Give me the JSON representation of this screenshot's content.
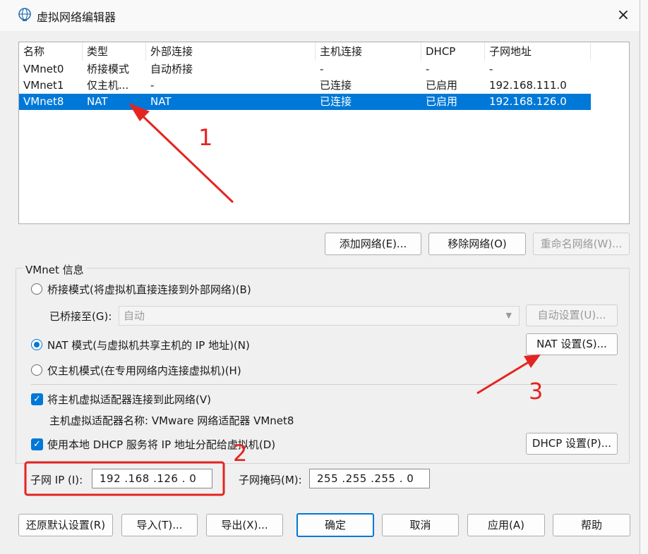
{
  "window": {
    "title": "虚拟网络编辑器",
    "close_icon": "×"
  },
  "table": {
    "headers": [
      "名称",
      "类型",
      "外部连接",
      "主机连接",
      "DHCP",
      "子网地址"
    ],
    "rows": [
      [
        "VMnet0",
        "桥接模式",
        "自动桥接",
        "-",
        "-",
        "-"
      ],
      [
        "VMnet1",
        "仅主机...",
        "-",
        "已连接",
        "已启用",
        "192.168.111.0"
      ],
      [
        "VMnet8",
        "NAT",
        "NAT",
        "已连接",
        "已启用",
        "192.168.126.0"
      ]
    ],
    "selected_row": 2
  },
  "list_buttons": {
    "add": "添加网络(E)...",
    "remove": "移除网络(O)",
    "rename": "重命名网络(W)..."
  },
  "info": {
    "group_label": "VMnet 信息",
    "bridge_mode": "桥接模式(将虚拟机直接连接到外部网络)(B)",
    "bridged_to_label": "已桥接至(G):",
    "bridged_to_value": "自动",
    "auto_settings": "自动设置(U)...",
    "nat_mode": "NAT 模式(与虚拟机共享主机的 IP 地址)(N)",
    "nat_settings": "NAT 设置(S)...",
    "host_only_mode": "仅主机模式(在专用网络内连接虚拟机)(H)",
    "connect_adapter": "将主机虚拟适配器连接到此网络(V)",
    "adapter_name": "主机虚拟适配器名称: VMware 网络适配器 VMnet8",
    "use_dhcp": "使用本地 DHCP 服务将 IP 地址分配给虚拟机(D)",
    "dhcp_settings": "DHCP 设置(P)...",
    "subnet_ip_label": "子网 IP (I):",
    "subnet_ip": "192 .168 .126 .  0",
    "subnet_mask_label": "子网掩码(M):",
    "subnet_mask": "255 .255 .255 .  0"
  },
  "bottom_buttons": {
    "restore": "还原默认设置(R)",
    "import": "导入(T)...",
    "export": "导出(X)...",
    "ok": "确定",
    "cancel": "取消",
    "apply": "应用(A)",
    "help": "帮助"
  },
  "annotations": {
    "one": "1",
    "two": "2",
    "three": "3",
    "color": "#e52421"
  }
}
